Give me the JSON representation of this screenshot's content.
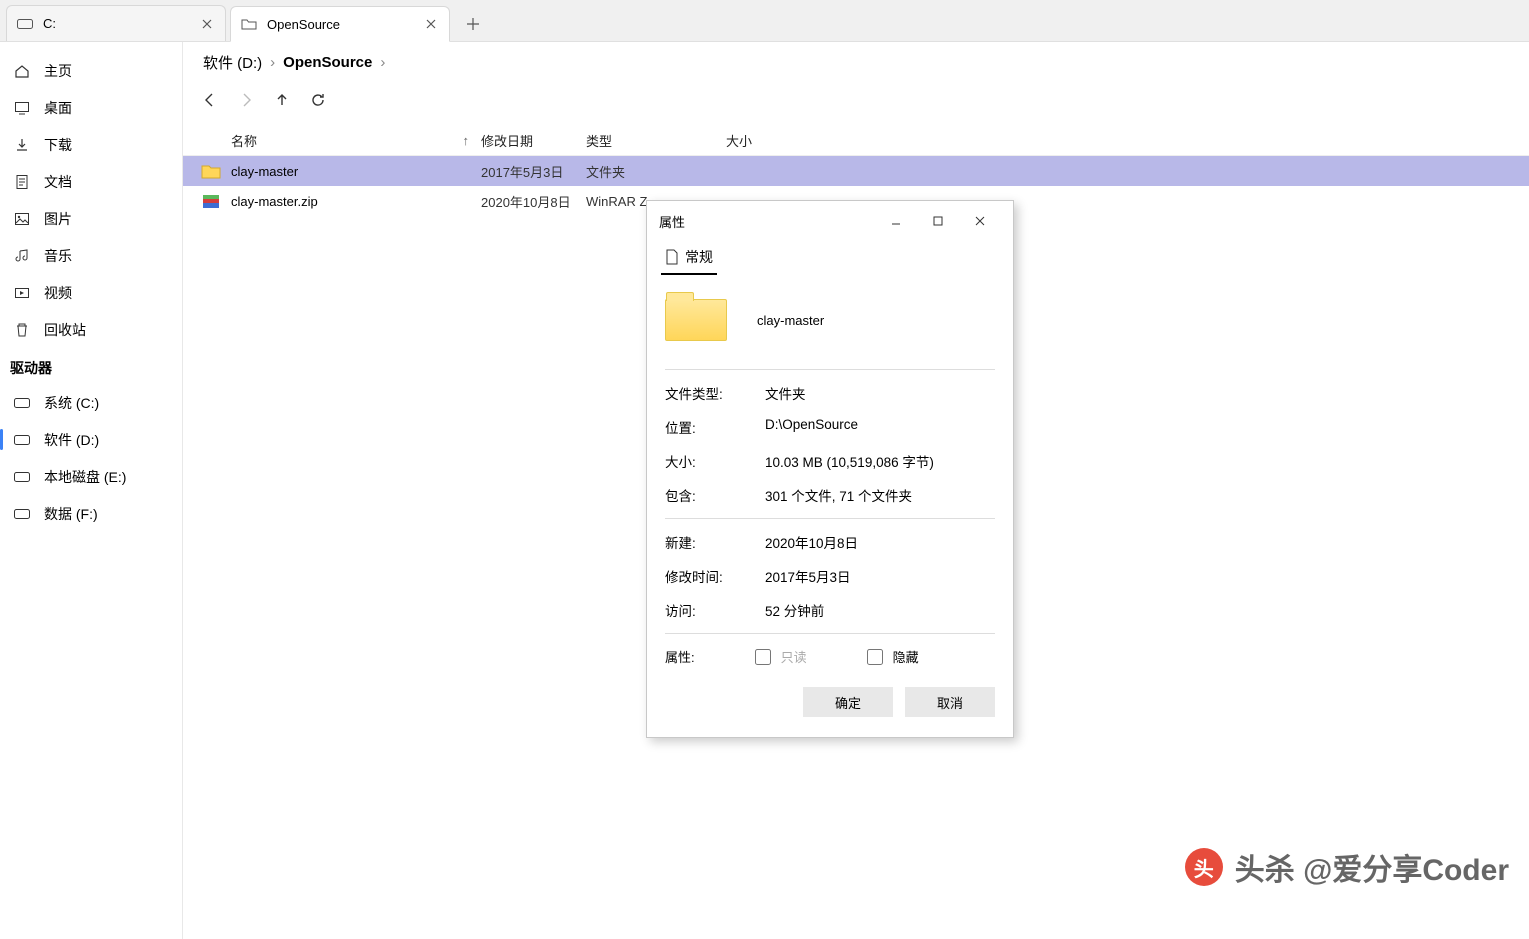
{
  "tabs": [
    {
      "label": "C:"
    },
    {
      "label": "OpenSource"
    }
  ],
  "sidebar": {
    "home": "主页",
    "desktop": "桌面",
    "downloads": "下载",
    "documents": "文档",
    "pictures": "图片",
    "music": "音乐",
    "videos": "视频",
    "recycle": "回收站",
    "drives_header": "驱动器",
    "drive_c": "系统 (C:)",
    "drive_d": "软件 (D:)",
    "drive_e": "本地磁盘 (E:)",
    "drive_f": "数据 (F:)"
  },
  "breadcrumb": {
    "root": "软件 (D:)",
    "folder": "OpenSource"
  },
  "columns": {
    "name": "名称",
    "date": "修改日期",
    "type": "类型",
    "size": "大小"
  },
  "files": [
    {
      "name": "clay-master",
      "date": "2017年5月3日",
      "type": "文件夹",
      "icon": "folder"
    },
    {
      "name": "clay-master.zip",
      "date": "2020年10月8日",
      "type": "WinRAR Z",
      "icon": "archive"
    }
  ],
  "dialog": {
    "title": "属性",
    "tab": "常规",
    "name": "clay-master",
    "rows": {
      "filetype_l": "文件类型:",
      "filetype_v": "文件夹",
      "location_l": "位置:",
      "location_v": "D:\\OpenSource",
      "size_l": "大小:",
      "size_v": "10.03 MB (10,519,086 字节)",
      "contains_l": "包含:",
      "contains_v": "301 个文件, 71 个文件夹",
      "created_l": "新建:",
      "created_v": "2020年10月8日",
      "modified_l": "修改时间:",
      "modified_v": "2017年5月3日",
      "accessed_l": "访问:",
      "accessed_v": "52 分钟前",
      "attrs_l": "属性:",
      "readonly": "只读",
      "hidden": "隐藏"
    },
    "ok": "确定",
    "cancel": "取消"
  },
  "watermark": "头杀 @爱分享Coder"
}
